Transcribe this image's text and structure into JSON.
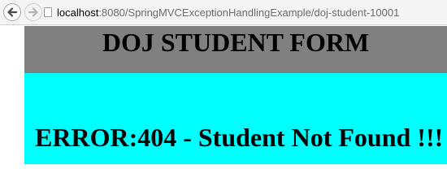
{
  "browser": {
    "url_host": "localhost",
    "url_path": ":8080/SpringMVCExceptionHandlingExample/doj-student-10001",
    "back_icon": "arrow-left-icon",
    "forward_icon": "arrow-right-icon",
    "page_icon": "page-icon"
  },
  "page": {
    "header_title": "DOJ STUDENT FORM",
    "error_message": "ERROR:404 - Student Not Found !!!"
  },
  "colors": {
    "header_bg": "#808080",
    "content_bg": "#00ffff",
    "text": "#000000"
  }
}
